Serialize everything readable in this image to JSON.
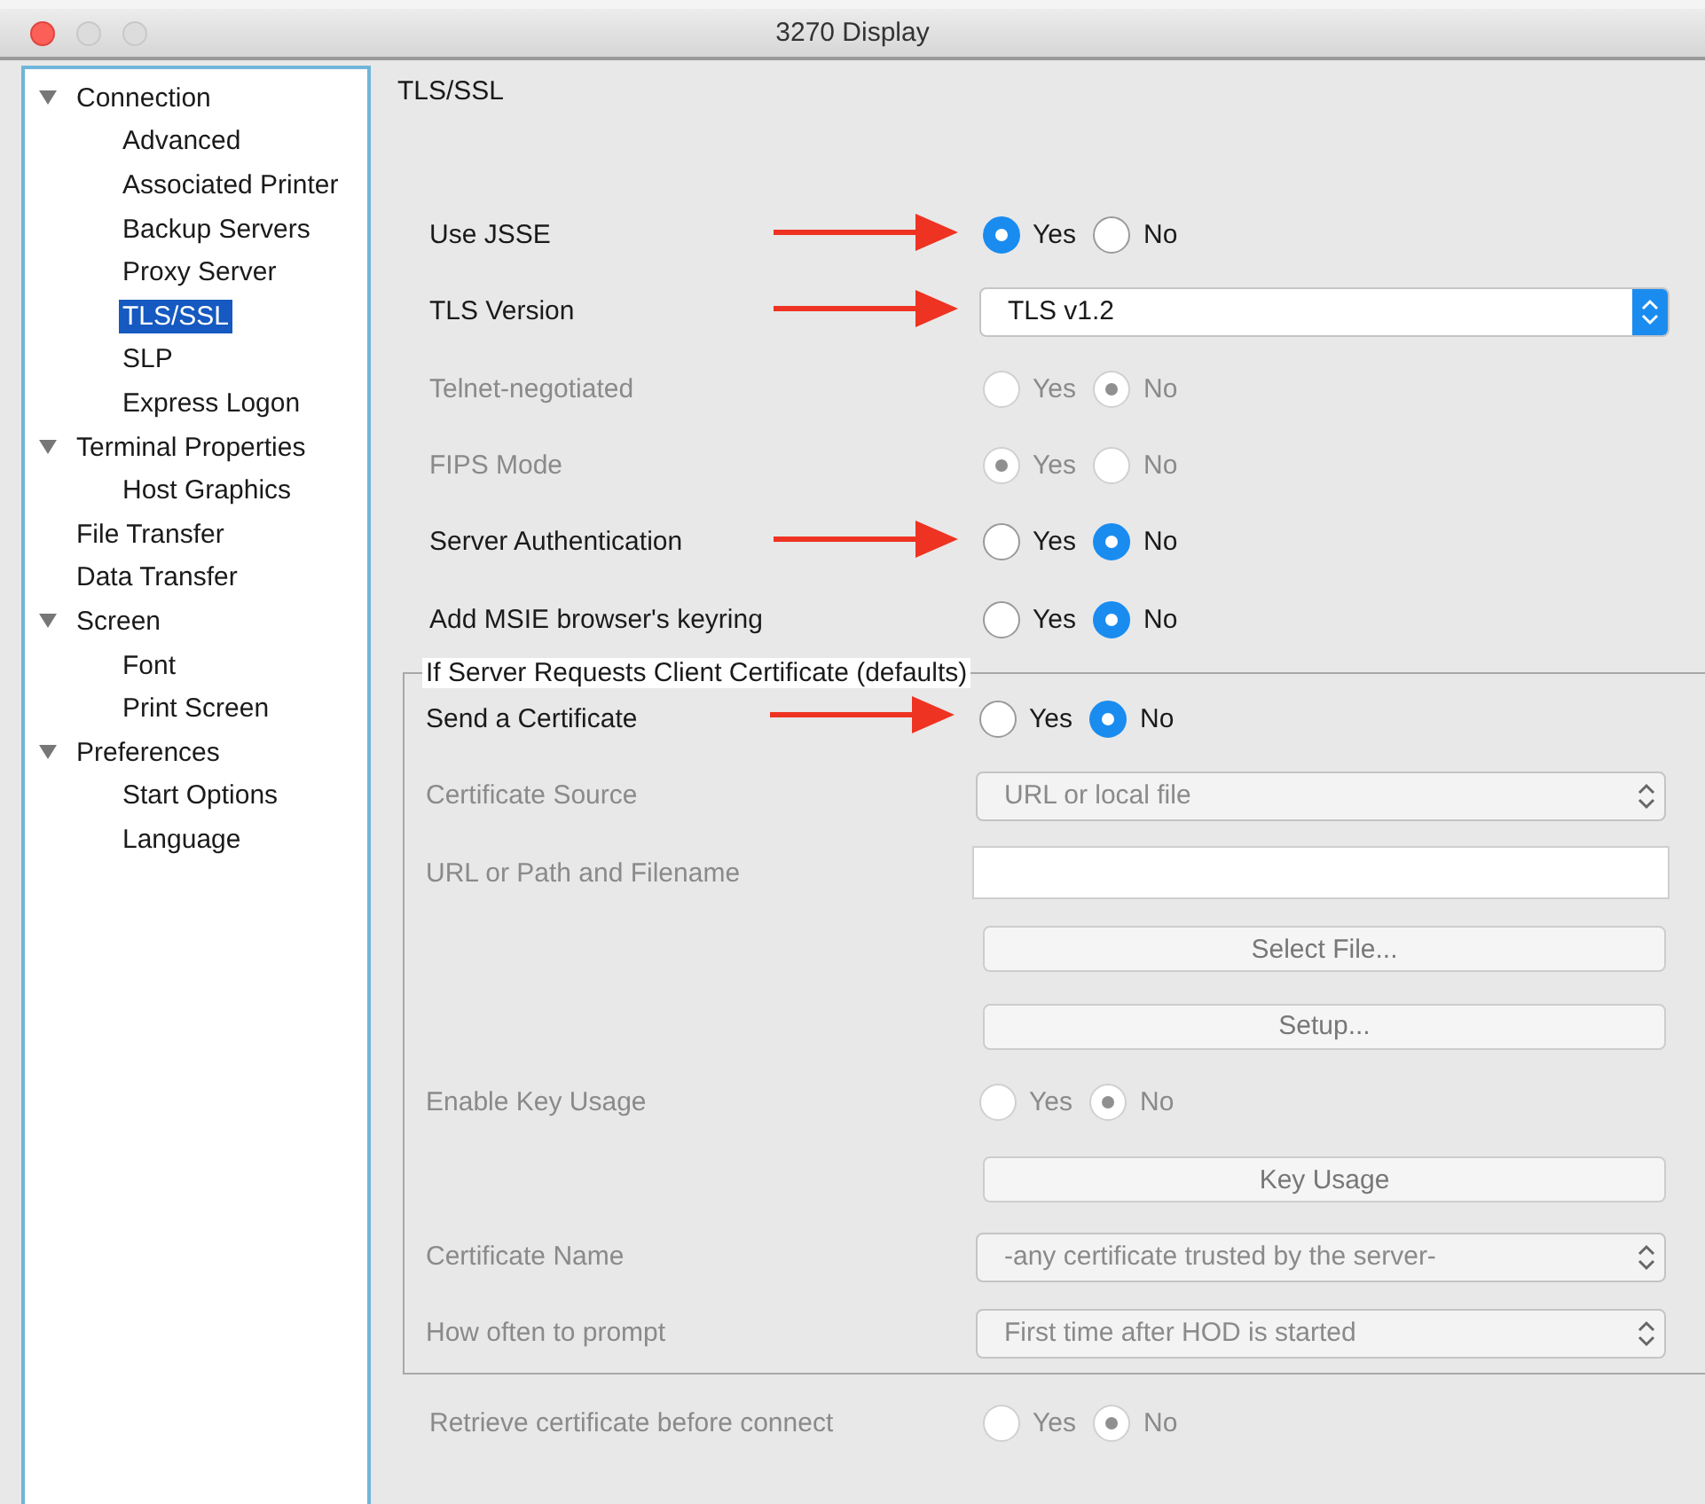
{
  "window": {
    "title": "3270 Display"
  },
  "sidebar": {
    "items": [
      {
        "label": "Connection",
        "selected": false,
        "expanded": true,
        "children": [
          {
            "label": "Advanced",
            "selected": false
          },
          {
            "label": "Associated Printer",
            "selected": false
          },
          {
            "label": "Backup Servers",
            "selected": false
          },
          {
            "label": "Proxy Server",
            "selected": false
          },
          {
            "label": "TLS/SSL",
            "selected": true
          },
          {
            "label": "SLP",
            "selected": false
          },
          {
            "label": "Express Logon",
            "selected": false
          }
        ]
      },
      {
        "label": "Terminal Properties",
        "selected": false,
        "expanded": true,
        "children": [
          {
            "label": "Host Graphics",
            "selected": false
          }
        ]
      },
      {
        "label": "File Transfer",
        "selected": false
      },
      {
        "label": "Data Transfer",
        "selected": false
      },
      {
        "label": "Screen",
        "selected": false,
        "expanded": true,
        "children": [
          {
            "label": "Font",
            "selected": false
          },
          {
            "label": "Print Screen",
            "selected": false
          }
        ]
      },
      {
        "label": "Preferences",
        "selected": false,
        "expanded": true,
        "children": [
          {
            "label": "Start Options",
            "selected": false
          },
          {
            "label": "Language",
            "selected": false
          }
        ]
      }
    ]
  },
  "panel": {
    "title": "TLS/SSL",
    "rows": [
      {
        "kind": "radio",
        "label": "Use JSSE",
        "disabled": false,
        "arrow": true,
        "options": [
          {
            "label": "Yes",
            "selected": true
          },
          {
            "label": "No",
            "selected": false
          }
        ]
      },
      {
        "kind": "select",
        "label": "TLS Version",
        "disabled": false,
        "arrow": true,
        "value": "TLS v1.2"
      },
      {
        "kind": "radio",
        "label": "Telnet-negotiated",
        "disabled": true,
        "options": [
          {
            "label": "Yes",
            "selected": false
          },
          {
            "label": "No",
            "selected": true
          }
        ]
      },
      {
        "kind": "radio",
        "label": "FIPS Mode",
        "disabled": true,
        "options": [
          {
            "label": "Yes",
            "selected": true
          },
          {
            "label": "No",
            "selected": false
          }
        ]
      },
      {
        "kind": "radio",
        "label": "Server Authentication",
        "disabled": false,
        "arrow": true,
        "options": [
          {
            "label": "Yes",
            "selected": false
          },
          {
            "label": "No",
            "selected": true
          }
        ]
      },
      {
        "kind": "radio",
        "label": "Add MSIE browser's keyring",
        "disabled": false,
        "options": [
          {
            "label": "Yes",
            "selected": false
          },
          {
            "label": "No",
            "selected": true
          }
        ]
      }
    ],
    "group": {
      "title": "If Server Requests Client Certificate (defaults)",
      "rows": [
        {
          "kind": "radio",
          "label": "Send a Certificate",
          "disabled": false,
          "arrow": true,
          "options": [
            {
              "label": "Yes",
              "selected": false
            },
            {
              "label": "No",
              "selected": true
            }
          ]
        },
        {
          "kind": "select",
          "label": "Certificate Source",
          "disabled": true,
          "value": "URL or local file"
        },
        {
          "kind": "field",
          "label": "URL or Path and Filename",
          "disabled": true
        },
        {
          "kind": "button",
          "disabled": true,
          "button": "Select File..."
        },
        {
          "kind": "button",
          "disabled": true,
          "button": "Setup..."
        },
        {
          "kind": "radio",
          "label": "Enable Key Usage",
          "disabled": true,
          "options": [
            {
              "label": "Yes",
              "selected": false
            },
            {
              "label": "No",
              "selected": true
            }
          ]
        },
        {
          "kind": "button",
          "disabled": true,
          "button": "Key Usage"
        },
        {
          "kind": "select",
          "label": "Certificate Name",
          "disabled": true,
          "value": "-any certificate trusted by the server-"
        },
        {
          "kind": "select",
          "label": "How often to prompt",
          "disabled": true,
          "value": "First time after HOD is started"
        }
      ]
    },
    "footer_rows": [
      {
        "kind": "radio",
        "label": "Retrieve certificate before connect",
        "disabled": true,
        "options": [
          {
            "label": "Yes",
            "selected": false
          },
          {
            "label": "No",
            "selected": true
          }
        ]
      }
    ]
  }
}
